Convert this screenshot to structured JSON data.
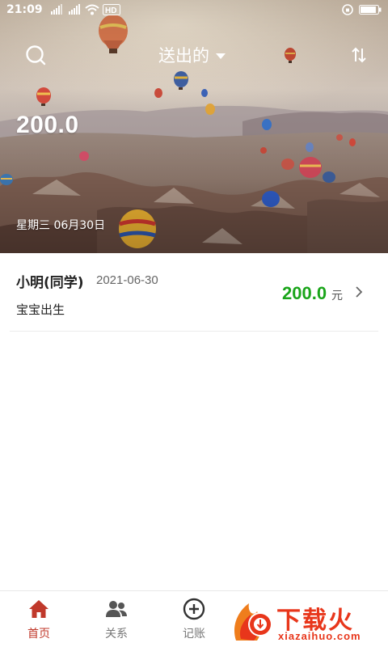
{
  "status_bar": {
    "time": "21:09",
    "network_badges": [
      "2G",
      "4G"
    ],
    "hd_label": "HD",
    "battery_level": 0.9
  },
  "header": {
    "title": "送出的",
    "search_icon": "search-icon",
    "sort_icon": "sort-icon"
  },
  "summary": {
    "total": "200.0",
    "date": "星期三 06月30日"
  },
  "records": [
    {
      "name": "小明(同学)",
      "date": "2021-06-30",
      "note": "宝宝出生",
      "amount": "200.0",
      "unit": "元"
    }
  ],
  "nav": {
    "items": [
      {
        "label": "首页",
        "icon": "home-icon",
        "active": true
      },
      {
        "label": "关系",
        "icon": "contacts-icon",
        "active": false
      },
      {
        "label": "记账",
        "icon": "add-circle-icon",
        "active": false
      }
    ]
  },
  "watermark": {
    "brand": "下载火",
    "site": "xiazaihuo.com"
  },
  "colors": {
    "accent": "#c0392b",
    "amount_green": "#1aa51a",
    "watermark_red": "#e8361b"
  }
}
